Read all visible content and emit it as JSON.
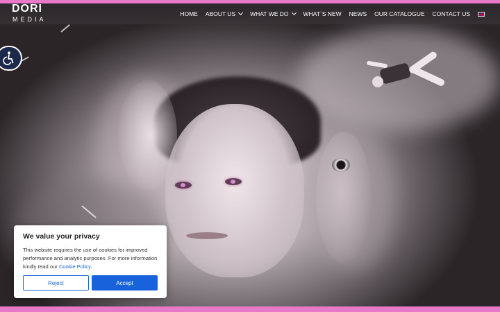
{
  "brand": {
    "logo_top": "DORI",
    "logo_bottom": "MEDIA"
  },
  "nav": {
    "items": [
      {
        "label": "HOME",
        "dropdown": false
      },
      {
        "label": "ABOUT US",
        "dropdown": true
      },
      {
        "label": "WHAT WE DO",
        "dropdown": true
      },
      {
        "label": "WHAT`S NEW",
        "dropdown": false
      },
      {
        "label": "NEWS",
        "dropdown": false
      },
      {
        "label": "OUR CATALOGUE",
        "dropdown": false
      },
      {
        "label": "CONTACT US",
        "dropdown": false
      }
    ],
    "language_icon": "uk-flag-icon"
  },
  "accessibility": {
    "icon": "wheelchair-icon"
  },
  "cookie_banner": {
    "title": "We value your privacy",
    "text": "This website requires the use of cookies for improved performance and analytic purposes. For more information kindly read our",
    "link_text": "Cookie Policy",
    "after_link": ".",
    "reject_label": "Reject",
    "accept_label": "Accept"
  },
  "colors": {
    "accent_pink": "#e879c9",
    "accept_blue": "#1863dc",
    "accessibility_navy": "#1b2a4a"
  }
}
